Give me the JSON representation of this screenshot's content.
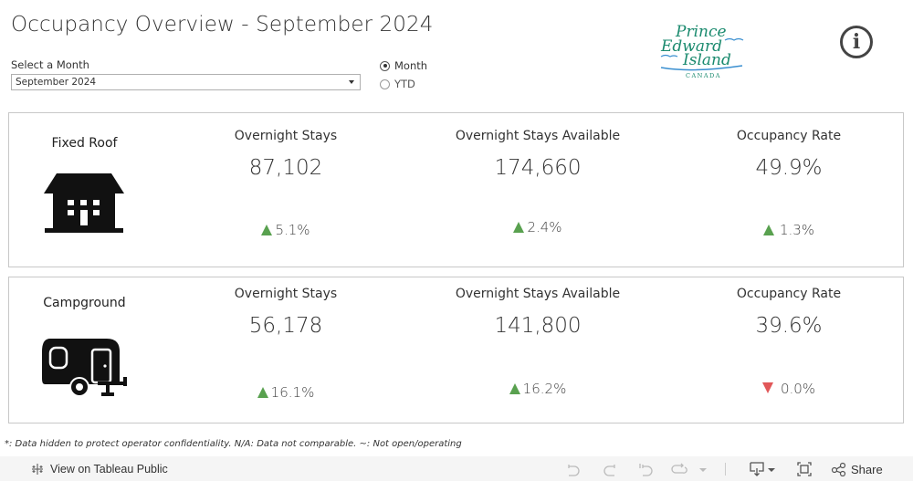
{
  "header": {
    "title": "Occupancy Overview - September 2024",
    "filter_label": "Select a Month",
    "filter_value": "September 2024",
    "period_options": [
      {
        "label": "Month",
        "checked": true
      },
      {
        "label": "YTD",
        "checked": false
      }
    ],
    "logo": {
      "line1": "Prince",
      "line2": "Edward",
      "line3": "Island",
      "line4": "CANADA"
    },
    "info_icon": "i"
  },
  "categories": [
    {
      "name": "Fixed Roof",
      "icon": "house-icon",
      "metrics": [
        {
          "label": "Overnight Stays",
          "value": "87,102",
          "change": "5.1%",
          "direction": "up"
        },
        {
          "label": "Overnight Stays Available",
          "value": "174,660",
          "change": "2.4%",
          "direction": "up"
        },
        {
          "label": "Occupancy Rate",
          "value": "49.9%",
          "change": "1.3%",
          "direction": "up"
        }
      ]
    },
    {
      "name": "Campground",
      "icon": "camper-trailer-icon",
      "metrics": [
        {
          "label": "Overnight Stays",
          "value": "56,178",
          "change": "16.1%",
          "direction": "up"
        },
        {
          "label": "Overnight Stays Available",
          "value": "141,800",
          "change": "16.2%",
          "direction": "up"
        },
        {
          "label": "Occupancy Rate",
          "value": "39.6%",
          "change": "0.0%",
          "direction": "down"
        }
      ]
    }
  ],
  "colors": {
    "up": "#59a14f",
    "down": "#e15759",
    "logo_green": "#1a8a6e",
    "logo_blue": "#3a8fd0"
  },
  "footnote": "*: Data hidden to protect operator confidentiality.  N/A: Data not comparable.  ~: Not open/operating",
  "toolbar": {
    "view_label": "View on Tableau Public",
    "share_label": "Share"
  }
}
